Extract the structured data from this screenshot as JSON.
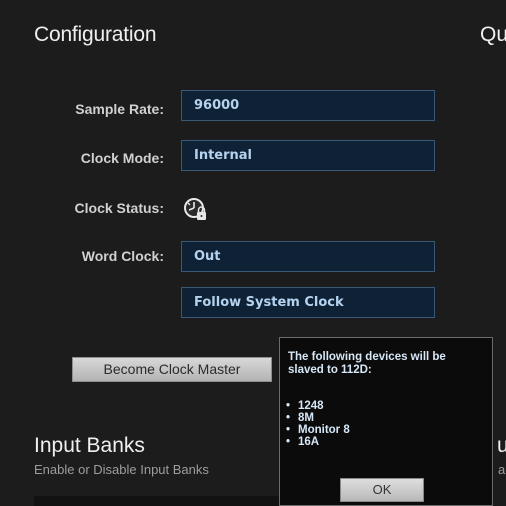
{
  "config": {
    "title": "Configuration",
    "right_title_cut": "Qu",
    "rows": [
      {
        "label": "Sample Rate:",
        "value": "96000"
      },
      {
        "label": "Clock Mode:",
        "value": "Internal"
      },
      {
        "label": "Clock Status:",
        "icon": "clock-lock-icon"
      },
      {
        "label": "Word Clock:",
        "value": "Out"
      },
      {
        "label": "",
        "value": "Follow System Clock"
      }
    ],
    "become_master_label": "Become Clock Master"
  },
  "popup": {
    "message": "The following devices will be slaved to 112D:",
    "devices": [
      "1248",
      "8M",
      "Monitor 8",
      "16A"
    ],
    "ok_label": "OK"
  },
  "input_banks": {
    "title": "Input Banks",
    "subtitle": "Enable or Disable Input Banks",
    "right_title_cut": "u",
    "right_sub_cut": "a"
  },
  "colors": {
    "background": "#1c1c1c",
    "field_bg": "#0e2135",
    "field_text": "#b5d3ef"
  }
}
